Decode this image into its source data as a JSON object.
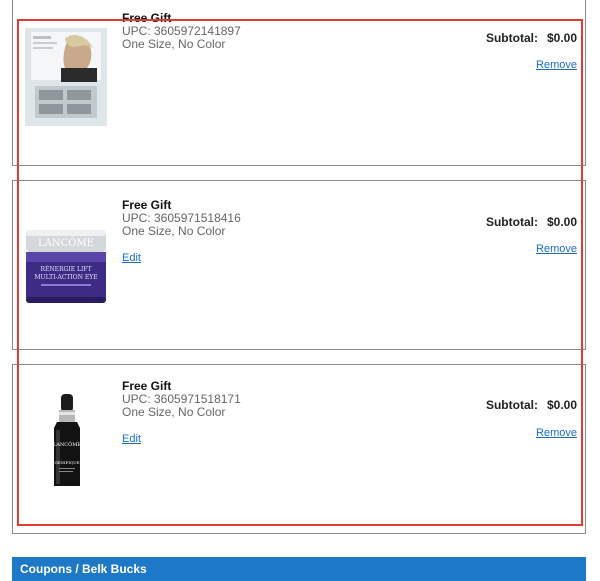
{
  "items": [
    {
      "title": "Free Gift",
      "upc": "UPC: 3605972141897",
      "variant": "One Size, No Color",
      "subtotal_label": "Subtotal:",
      "subtotal_value": "$0.00",
      "remove_label": "Remove"
    },
    {
      "title": "Free Gift",
      "upc": "UPC: 3605971518416",
      "variant": "One Size, No Color",
      "edit_label": "Edit",
      "subtotal_label": "Subtotal:",
      "subtotal_value": "$0.00",
      "remove_label": "Remove",
      "image_text": {
        "brand": "LANCÔME",
        "line1": "RÉNERGIE LIFT",
        "line2": "MULTI-ACTION EYE"
      }
    },
    {
      "title": "Free Gift",
      "upc": "UPC: 3605971518171",
      "variant": "One Size, No Color",
      "edit_label": "Edit",
      "subtotal_label": "Subtotal:",
      "subtotal_value": "$0.00",
      "remove_label": "Remove",
      "image_text": {
        "brand": "LANCÔME",
        "line1": "GÉNIFIQUE"
      }
    }
  ],
  "coupons": {
    "label": "Coupons / Belk Bucks"
  },
  "colors": {
    "link": "#1a6fc4",
    "highlight": "#e53935",
    "bar": "#1e78c8"
  },
  "icons": [
    "lancome-sample-card-image",
    "lancome-eye-cream-jar-image",
    "lancome-serum-bottle-image"
  ]
}
